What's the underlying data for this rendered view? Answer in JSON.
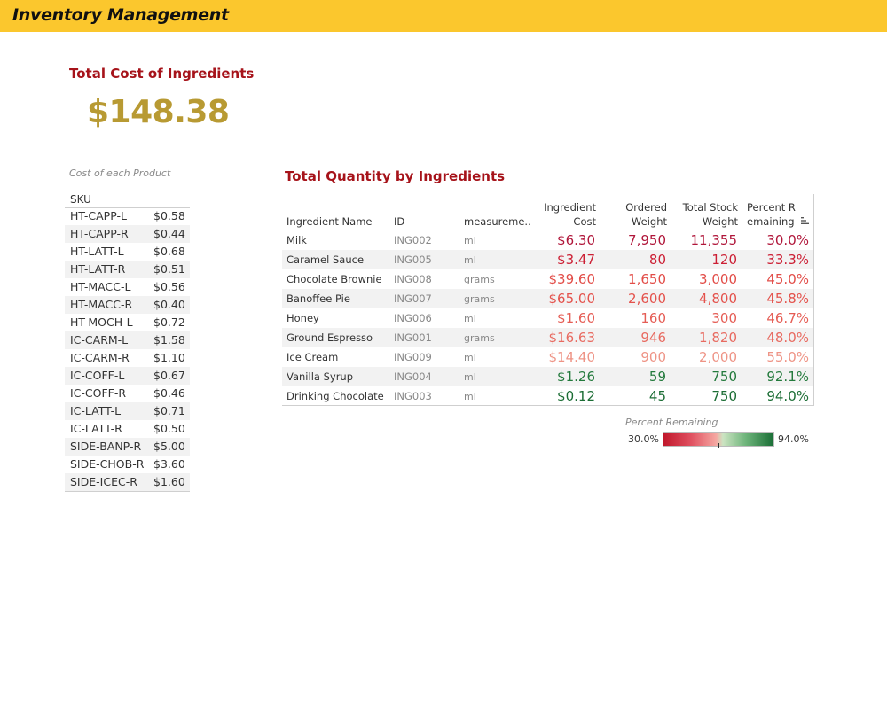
{
  "header": {
    "title": "Inventory Management"
  },
  "kpi": {
    "title": "Total Cost of Ingredients",
    "value": "$148.38"
  },
  "cost_table": {
    "caption": "Cost of each Product",
    "header_sku": "SKU",
    "rows": [
      {
        "sku": "HT-CAPP-L",
        "cost": "$0.58"
      },
      {
        "sku": "HT-CAPP-R",
        "cost": "$0.44"
      },
      {
        "sku": "HT-LATT-L",
        "cost": "$0.68"
      },
      {
        "sku": "HT-LATT-R",
        "cost": "$0.51"
      },
      {
        "sku": "HT-MACC-L",
        "cost": "$0.56"
      },
      {
        "sku": "HT-MACC-R",
        "cost": "$0.40"
      },
      {
        "sku": "HT-MOCH-L",
        "cost": "$0.72"
      },
      {
        "sku": "IC-CARM-L",
        "cost": "$1.58"
      },
      {
        "sku": "IC-CARM-R",
        "cost": "$1.10"
      },
      {
        "sku": "IC-COFF-L",
        "cost": "$0.67"
      },
      {
        "sku": "IC-COFF-R",
        "cost": "$0.46"
      },
      {
        "sku": "IC-LATT-L",
        "cost": "$0.71"
      },
      {
        "sku": "IC-LATT-R",
        "cost": "$0.50"
      },
      {
        "sku": "SIDE-BANP-R",
        "cost": "$5.00"
      },
      {
        "sku": "SIDE-CHOB-R",
        "cost": "$3.60"
      },
      {
        "sku": "SIDE-ICEC-R",
        "cost": "$1.60"
      }
    ]
  },
  "qty_table": {
    "title": "Total Quantity by Ingredients",
    "headers": {
      "name": "Ingredient Name",
      "id": "ID",
      "measurement": "measureme..",
      "cost_l1": "Ingredient",
      "cost_l2": "Cost",
      "ordered_l1": "Ordered",
      "ordered_l2": "Weight",
      "stock_l1": "Total Stock",
      "stock_l2": "Weight",
      "pct_l1": "Percent R",
      "pct_l2": "emaining"
    },
    "sort_icon": "sort-descending-icon",
    "rows": [
      {
        "name": "Milk",
        "id": "ING002",
        "measurement": "ml",
        "cost": "$6.30",
        "ordered": "7,950",
        "stock": "11,355",
        "pct": "30.0%",
        "color": "#b0163a"
      },
      {
        "name": "Caramel Sauce",
        "id": "ING005",
        "measurement": "ml",
        "cost": "$3.47",
        "ordered": "80",
        "stock": "120",
        "pct": "33.3%",
        "color": "#cc1f34"
      },
      {
        "name": "Chocolate Brownie",
        "id": "ING008",
        "measurement": "grams",
        "cost": "$39.60",
        "ordered": "1,650",
        "stock": "3,000",
        "pct": "45.0%",
        "color": "#e24d48"
      },
      {
        "name": "Banoffee Pie",
        "id": "ING007",
        "measurement": "grams",
        "cost": "$65.00",
        "ordered": "2,600",
        "stock": "4,800",
        "pct": "45.8%",
        "color": "#e4524c"
      },
      {
        "name": "Honey",
        "id": "ING006",
        "measurement": "ml",
        "cost": "$1.60",
        "ordered": "160",
        "stock": "300",
        "pct": "46.7%",
        "color": "#e55d55"
      },
      {
        "name": "Ground Espresso",
        "id": "ING001",
        "measurement": "grams",
        "cost": "$16.63",
        "ordered": "946",
        "stock": "1,820",
        "pct": "48.0%",
        "color": "#e86a60"
      },
      {
        "name": "Ice Cream",
        "id": "ING009",
        "measurement": "ml",
        "cost": "$14.40",
        "ordered": "900",
        "stock": "2,000",
        "pct": "55.0%",
        "color": "#ee9486"
      },
      {
        "name": "Vanilla Syrup",
        "id": "ING004",
        "measurement": "ml",
        "cost": "$1.26",
        "ordered": "59",
        "stock": "750",
        "pct": "92.1%",
        "color": "#237a3c"
      },
      {
        "name": "Drinking Chocolate",
        "id": "ING003",
        "measurement": "ml",
        "cost": "$0.12",
        "ordered": "45",
        "stock": "750",
        "pct": "94.0%",
        "color": "#1b6d34"
      }
    ]
  },
  "legend": {
    "title": "Percent Remaining",
    "min": "30.0%",
    "max": "94.0%",
    "low_color": "#c0182b",
    "high_color": "#1a6e36"
  }
}
